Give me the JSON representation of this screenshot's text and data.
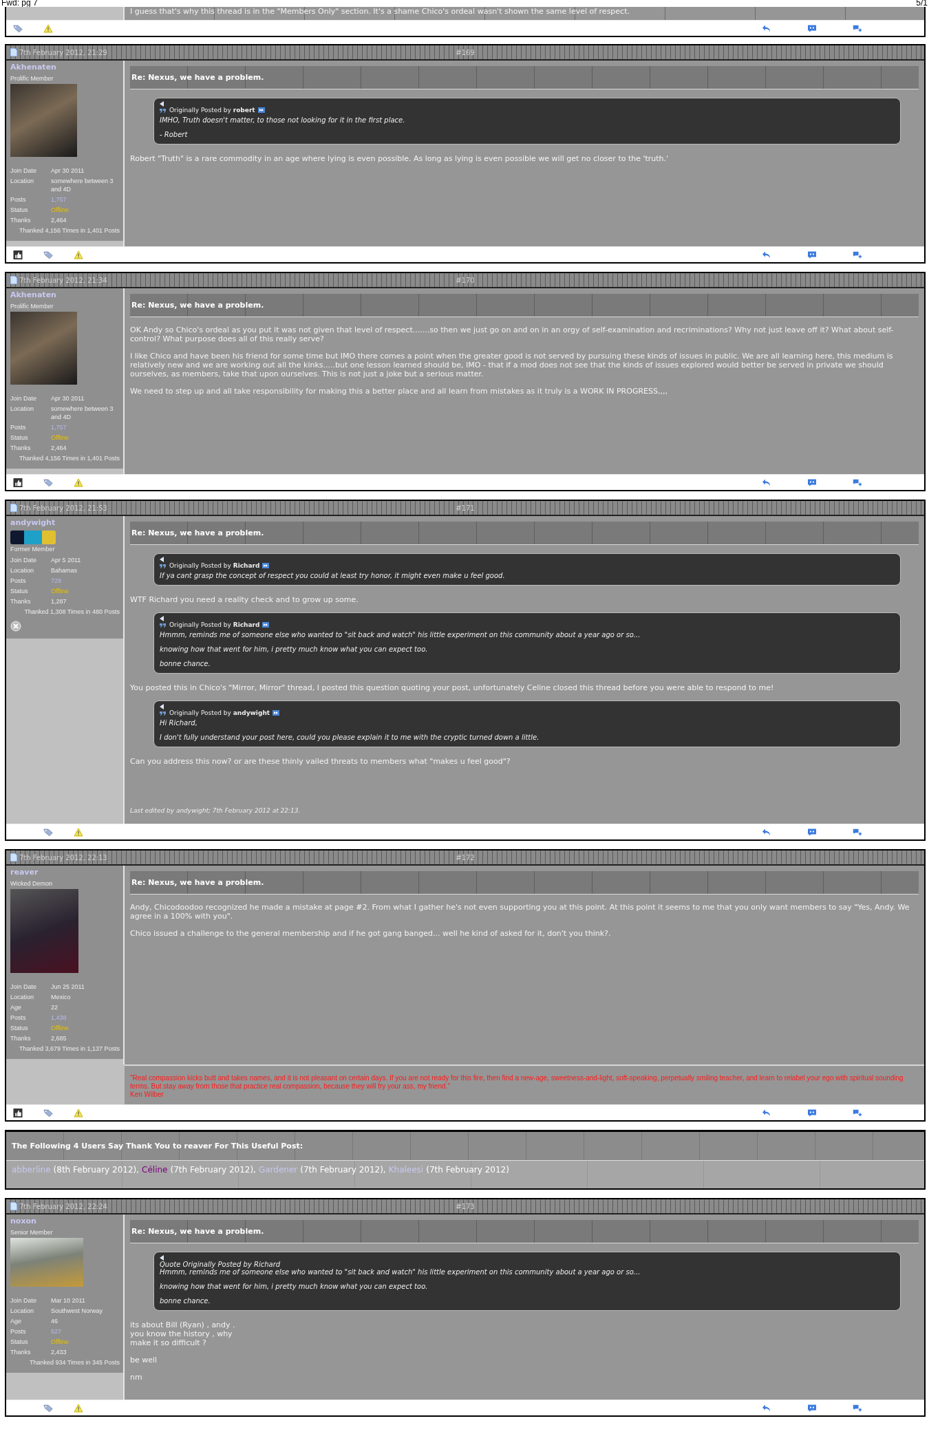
{
  "page_header": {
    "title": "Fwd: pg 7",
    "page": "5/1"
  },
  "partial_post": {
    "text": "I guess that's why this thread is in the \"Members Only\" section. It's a shame Chico's ordeal wasn't shown the same level of respect."
  },
  "posts": [
    {
      "date": "7th February 2012, 21:29",
      "number": "#169",
      "user": {
        "name": "Akhenaten",
        "rank": "Prolific Member",
        "avatar": {
          "kind": "portrait"
        },
        "fields": [
          {
            "label": "Join Date",
            "value": "Apr 30 2011",
            "kind": "plain"
          },
          {
            "label": "Location",
            "value": "somewhere between 3 and 4D",
            "kind": "plain"
          },
          {
            "label": "Posts",
            "value": "1,757",
            "kind": "link"
          },
          {
            "label": "Status",
            "value": "Offline",
            "kind": "status"
          },
          {
            "label": "Thanks",
            "value": "2,464",
            "kind": "plain"
          }
        ],
        "thanked": "Thanked 4,156 Times in 1,401 Posts"
      },
      "title": "Re: Nexus, we have a problem.",
      "blocks": [
        {
          "kind": "quote",
          "attribution": "Originally Posted by **robert**",
          "lines": [
            "IMHO, Truth doesn't matter, to those not looking for it in the first place.",
            "- Robert"
          ]
        },
        {
          "kind": "text",
          "text": "Robert \"Truth\" is a rare commodity in an age where lying is even possible. As long as lying is even possible we will get no closer to the 'truth.'"
        }
      ],
      "thanks_button": true
    },
    {
      "date": "7th February 2012, 21:34",
      "number": "#170",
      "user": {
        "name": "Akhenaten",
        "rank": "Prolific Member",
        "avatar": {
          "kind": "portrait"
        },
        "fields": [
          {
            "label": "Join Date",
            "value": "Apr 30 2011",
            "kind": "plain"
          },
          {
            "label": "Location",
            "value": "somewhere between 3 and 4D",
            "kind": "plain"
          },
          {
            "label": "Posts",
            "value": "1,757",
            "kind": "link"
          },
          {
            "label": "Status",
            "value": "Offline",
            "kind": "status"
          },
          {
            "label": "Thanks",
            "value": "2,464",
            "kind": "plain"
          }
        ],
        "thanked": "Thanked 4,156 Times in 1,401 Posts"
      },
      "title": "Re: Nexus, we have a problem.",
      "blocks": [
        {
          "kind": "text",
          "text": "OK Andy so Chico's ordeal as you put it was not given that level of respect.......so then we just go on and on in an orgy of self-examination and recriminations? Why not just leave off it? What about self-control? What purpose does all of this really serve?"
        },
        {
          "kind": "text",
          "text": "I like Chico and have been his friend for some time but IMO there comes a point when the greater good is not served by pursuing these kinds of issues in public. We are all learning here, this medium is relatively new and we are working out all the kinks.....but one lesson learned should be, IMO - that if a mod does not see that the kinds of issues explored would better be served in private we should ourselves, as members, take that upon ourselves. This is not just a joke but a serious matter."
        },
        {
          "kind": "text",
          "text": "We need to step up and all take responsibility for making this a better place and all learn from mistakes as it truly is a WORK IN PROGRESS,,,,"
        }
      ],
      "thanks_button": true
    },
    {
      "date": "7th February 2012, 21:53",
      "number": "#171",
      "user": {
        "name": "andywight",
        "rank": "Former Member",
        "avatar": {
          "kind": "banner"
        },
        "award_icon": true,
        "fields": [
          {
            "label": "Join Date",
            "value": "Apr 5 2011",
            "kind": "plain"
          },
          {
            "label": "Location",
            "value": "Bahamas",
            "kind": "plain"
          },
          {
            "label": "Posts",
            "value": "729",
            "kind": "link"
          },
          {
            "label": "Status",
            "value": "Offline",
            "kind": "status"
          },
          {
            "label": "Thanks",
            "value": "1,287",
            "kind": "plain"
          }
        ],
        "thanked": "Thanked 1,308 Times in 480 Posts"
      },
      "title": "Re: Nexus, we have a problem.",
      "blocks": [
        {
          "kind": "quote",
          "attribution": "Originally Posted by **Richard**",
          "lines": [
            "If ya cant grasp the concept of respect you could at least try honor, it might even make u feel good."
          ]
        },
        {
          "kind": "text",
          "text": "WTF Richard you need a reality check and to grow up some."
        },
        {
          "kind": "quote",
          "attribution": "Originally Posted by **Richard**",
          "lines": [
            "Hmmm, reminds me of someone else who wanted to \"sit back and watch\" his little experiment on this community about a year ago or so...",
            "knowing how that went for him, i pretty much know what you can expect too.",
            "bonne chance."
          ]
        },
        {
          "kind": "text",
          "text": "You posted this in Chico's \"Mirror, Mirror\" thread, I posted this question quoting your post, unfortunately Celine closed this thread before you were able to respond to me!"
        },
        {
          "kind": "quote",
          "attribution": "Originally Posted by **andywight**",
          "lines": [
            "Hi Richard,",
            "I don't fully understand your post here, could you please explain it to me with the cryptic turned down a little."
          ]
        },
        {
          "kind": "text",
          "text": "Can you address this now? or are these thinly vailed threats to members what \"makes u feel good\"?"
        },
        {
          "kind": "edit",
          "text": "Last edited by andywight; 7th February 2012 at 22:13."
        }
      ],
      "thanks_button": false
    },
    {
      "date": "7th February 2012, 22:13",
      "number": "#172",
      "user": {
        "name": "reaver",
        "rank": "Wicked Demon",
        "avatar": {
          "kind": "tall"
        },
        "fields": [
          {
            "label": "Join Date",
            "value": "Jun 25 2011",
            "kind": "plain"
          },
          {
            "label": "Location",
            "value": "Mexico",
            "kind": "plain"
          },
          {
            "label": "Age",
            "value": "22",
            "kind": "plain"
          },
          {
            "label": "Posts",
            "value": "1,438",
            "kind": "link"
          },
          {
            "label": "Status",
            "value": "Offline",
            "kind": "status"
          },
          {
            "label": "Thanks",
            "value": "2,685",
            "kind": "plain"
          }
        ],
        "thanked": "Thanked 3,679 Times in 1,137 Posts"
      },
      "title": "Re: Nexus, we have a problem.",
      "blocks": [
        {
          "kind": "text",
          "text": "Andy, Chicodoodoo recognized he made a mistake at page #2. From what I gather he's not even supporting you at this point. At this point it seems to me that you only want members to say \"Yes, Andy. We agree in a 100% with you\"."
        },
        {
          "kind": "text",
          "text": "Chico issued a challenge to the general membership and if he got gang banged... well he kind of asked for it, don't you think?."
        }
      ],
      "signature": [
        "\"Real compassion kicks butt and takes names, and it is not pleasant on certain days. If you are not ready for this fire, then find a new-age, sweetness-and-light, soft-speaking, perpetually smiling teacher, and learn to relabel your ego with spiritual sounding terms. But stay away from those that practice real compassion, because they will fry your ass, my friend.\"",
        "Ken Wilber"
      ],
      "thanks_button": true,
      "thanks": {
        "heading": "The Following 4 Users Say Thank You to reaver For This Useful Post:",
        "users": [
          {
            "name": "abberline",
            "color": "#c8c8f0",
            "date": "(8th February 2012),"
          },
          {
            "name": "Céline",
            "color": "#800080",
            "date": "(7th February 2012),"
          },
          {
            "name": "Gardener",
            "color": "#c8c8f0",
            "date": "(7th February 2012),"
          },
          {
            "name": "Khaleesi",
            "color": "#c8c8f0",
            "date": "(7th February 2012)"
          }
        ]
      }
    },
    {
      "date": "7th February 2012, 22:24",
      "number": "#173",
      "user": {
        "name": "noxon",
        "rank": "Senior Member",
        "avatar": {
          "kind": "landscape"
        },
        "fields": [
          {
            "label": "Join Date",
            "value": "Mar 10 2011",
            "kind": "plain"
          },
          {
            "label": "Location",
            "value": "Southwest Norway",
            "kind": "plain"
          },
          {
            "label": "Age",
            "value": "46",
            "kind": "plain"
          },
          {
            "label": "Posts",
            "value": "527",
            "kind": "link"
          },
          {
            "label": "Status",
            "value": "Offline",
            "kind": "status"
          },
          {
            "label": "Thanks",
            "value": "2,433",
            "kind": "plain"
          }
        ],
        "thanked": "Thanked 934 Times in 345 Posts"
      },
      "title": "Re: Nexus, we have a problem.",
      "blocks": [
        {
          "kind": "plain_quote",
          "attribution": "Quote Originally Posted by Richard",
          "lines": [
            "Hmmm, reminds me of someone else who wanted to \"sit back and watch\" his little experiment on this community about a year ago or so...",
            "knowing how that went for him, i pretty much know what you can expect too.",
            "bonne chance."
          ]
        },
        {
          "kind": "text",
          "text": "its about Bill (Ryan) , andy .\nyou know the history , why\nmake it so difficult ?"
        },
        {
          "kind": "text",
          "text": "be well"
        },
        {
          "kind": "text",
          "text": "nm"
        }
      ],
      "thanks_button": false
    }
  ]
}
